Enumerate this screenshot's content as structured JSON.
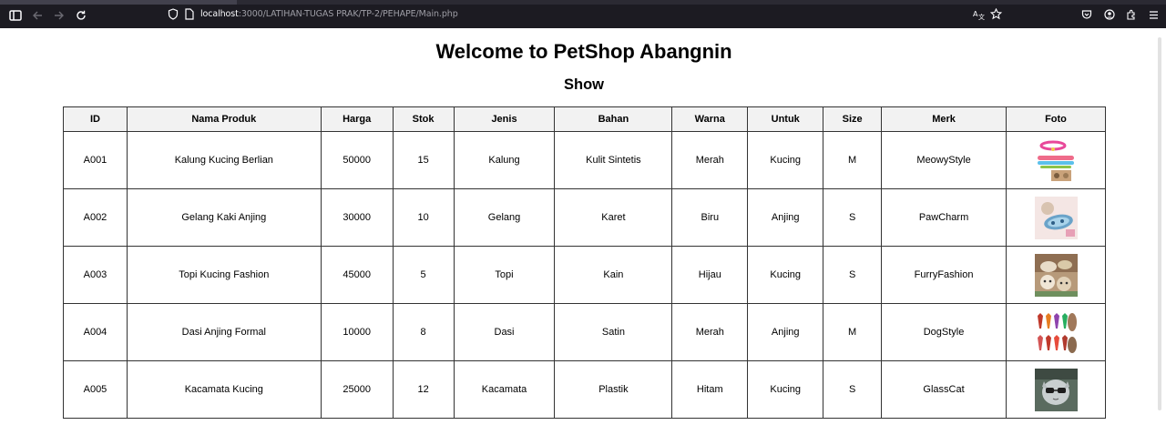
{
  "browser": {
    "url_host": "localhost",
    "url_path": ":3000/LATIHAN-TUGAS PRAK/TP-2/PEHAPE/Main.php"
  },
  "page": {
    "title": "Welcome to PetShop Abangnin",
    "subtitle": "Show"
  },
  "table": {
    "headers": [
      "ID",
      "Nama Produk",
      "Harga",
      "Stok",
      "Jenis",
      "Bahan",
      "Warna",
      "Untuk",
      "Size",
      "Merk",
      "Foto"
    ],
    "rows": [
      {
        "id": "A001",
        "nama": "Kalung Kucing Berlian",
        "harga": "50000",
        "stok": "15",
        "jenis": "Kalung",
        "bahan": "Kulit Sintetis",
        "warna": "Merah",
        "untuk": "Kucing",
        "size": "M",
        "merk": "MeowyStyle",
        "foto_icon": "cat-collar-photo"
      },
      {
        "id": "A002",
        "nama": "Gelang Kaki Anjing",
        "harga": "30000",
        "stok": "10",
        "jenis": "Gelang",
        "bahan": "Karet",
        "warna": "Biru",
        "untuk": "Anjing",
        "size": "S",
        "merk": "PawCharm",
        "foto_icon": "dog-bracelet-photo"
      },
      {
        "id": "A003",
        "nama": "Topi Kucing Fashion",
        "harga": "45000",
        "stok": "5",
        "jenis": "Topi",
        "bahan": "Kain",
        "warna": "Hijau",
        "untuk": "Kucing",
        "size": "S",
        "merk": "FurryFashion",
        "foto_icon": "cat-hat-photo"
      },
      {
        "id": "A004",
        "nama": "Dasi Anjing Formal",
        "harga": "10000",
        "stok": "8",
        "jenis": "Dasi",
        "bahan": "Satin",
        "warna": "Merah",
        "untuk": "Anjing",
        "size": "M",
        "merk": "DogStyle",
        "foto_icon": "dog-tie-photo"
      },
      {
        "id": "A005",
        "nama": "Kacamata Kucing",
        "harga": "25000",
        "stok": "12",
        "jenis": "Kacamata",
        "bahan": "Plastik",
        "warna": "Hitam",
        "untuk": "Kucing",
        "size": "S",
        "merk": "GlassCat",
        "foto_icon": "cat-glasses-photo"
      }
    ]
  },
  "colors": {
    "chrome_bg": "#1c1b22",
    "header_bg": "#f2f2f2",
    "border": "#333333"
  }
}
